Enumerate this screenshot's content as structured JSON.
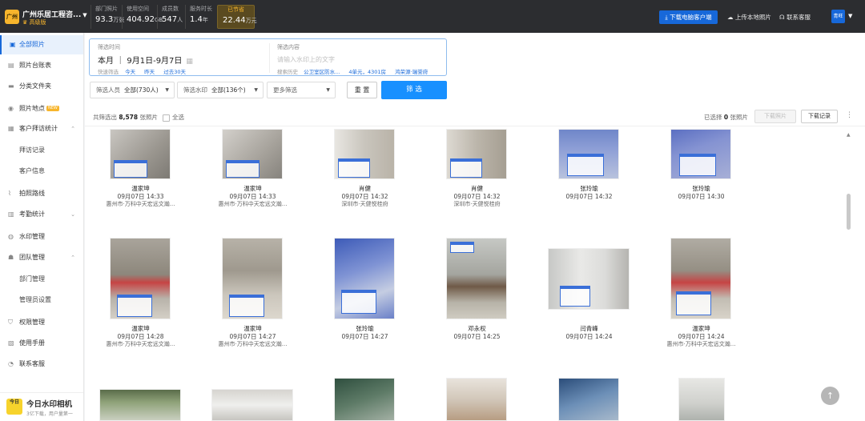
{
  "header": {
    "logo_text": "广州",
    "company": "广州乐居工程咨...",
    "edition": "高级版",
    "stats": [
      {
        "label": "部门照片",
        "value": "93.3",
        "unit": "万张"
      },
      {
        "label": "使用空间",
        "value": "404.92",
        "unit": "GB"
      },
      {
        "label": "成员数",
        "value": "547",
        "unit": "人"
      },
      {
        "label": "服务时长",
        "value": "1.4",
        "unit": "年"
      },
      {
        "label": "已节省",
        "value": "22.44",
        "unit": "万元"
      }
    ],
    "download_client": "下载电脑客户端",
    "upload_local": "上传本地照片",
    "contact_service": "联系客服",
    "user_initials": "青旺"
  },
  "sidebar": {
    "items": [
      {
        "label": "全部照片",
        "icon": "photo-icon"
      },
      {
        "label": "照片台账表",
        "icon": "ledger-icon"
      },
      {
        "label": "分类文件夹",
        "icon": "folder-icon"
      },
      {
        "label": "照片地点",
        "icon": "location-icon",
        "badge": "NEW"
      },
      {
        "label": "客户拜访统计",
        "icon": "chart-icon"
      },
      {
        "label": "拜访记录"
      },
      {
        "label": "客户信息"
      },
      {
        "label": "拍照路线",
        "icon": "route-icon"
      },
      {
        "label": "考勤统计",
        "icon": "calendar-icon"
      },
      {
        "label": "水印管理",
        "icon": "watermark-icon"
      },
      {
        "label": "团队管理",
        "icon": "team-icon"
      },
      {
        "label": "部门管理"
      },
      {
        "label": "管理员设置"
      },
      {
        "label": "权限管理",
        "icon": "shield-icon"
      },
      {
        "label": "使用手册",
        "icon": "book-icon"
      },
      {
        "label": "联系客服",
        "icon": "service-icon"
      }
    ],
    "brand_name": "今日水印相机",
    "brand_sub": "3亿下载，用户量第一",
    "brand_logo": "今日"
  },
  "filter": {
    "time_label": "筛选时间",
    "date_range": "本月 ｜ 9月1日-9月7日",
    "quick_label": "快速筛选",
    "quick_options": [
      "今天",
      "昨天",
      "过去30天"
    ],
    "content_label": "筛选内容",
    "search_placeholder": "请输入水印上的文字",
    "recent_label": "搜索历史",
    "recent_items": [
      "公卫室区防水...",
      "4单元，4301房",
      "鸿荣源·瑞誉府"
    ],
    "person_label": "筛选人员",
    "person_value": "全部(730人)",
    "watermark_label": "筛选水印",
    "watermark_value": "全部(136个)",
    "more_label": "更多筛选",
    "reset": "重 置",
    "submit": "筛 选"
  },
  "results": {
    "count_prefix": "共筛选出",
    "count": "8,578",
    "count_suffix": "张照片",
    "select_all": "全选",
    "selected_prefix": "已选择",
    "selected_count": "0",
    "selected_suffix": "张照片",
    "download_photos": "下载照片",
    "download_records": "下载记录"
  },
  "photos": [
    {
      "name": "温家坤",
      "time": "09月07日 14:33",
      "location": "惠州市·万科中天宏远文瀚..."
    },
    {
      "name": "温家坤",
      "time": "09月07日 14:33",
      "location": "惠州市·万科中天宏远文瀚..."
    },
    {
      "name": "肖健",
      "time": "09月07日 14:32",
      "location": "深圳市·天健悦桂府"
    },
    {
      "name": "肖健",
      "time": "09月07日 14:32",
      "location": "深圳市·天健悦桂府"
    },
    {
      "name": "张玲瑜",
      "time": "09月07日 14:32",
      "location": ""
    },
    {
      "name": "张玲瑜",
      "time": "09月07日 14:30",
      "location": ""
    },
    {
      "name": "温家坤",
      "time": "09月07日 14:28",
      "location": "惠州市·万科中天宏远文瀚..."
    },
    {
      "name": "温家坤",
      "time": "09月07日 14:27",
      "location": "惠州市·万科中天宏远文瀚..."
    },
    {
      "name": "张玲瑜",
      "time": "09月07日 14:27",
      "location": ""
    },
    {
      "name": "邓永权",
      "time": "09月07日 14:25",
      "location": ""
    },
    {
      "name": "闫青峰",
      "time": "09月07日 14:24",
      "location": ""
    },
    {
      "name": "温家坤",
      "time": "09月07日 14:24",
      "location": "惠州市·万科中天宏远文瀚..."
    }
  ],
  "colors": {
    "accent": "#1768d9",
    "topbar": "#2c2d30",
    "highlight": "#f7b52c"
  }
}
